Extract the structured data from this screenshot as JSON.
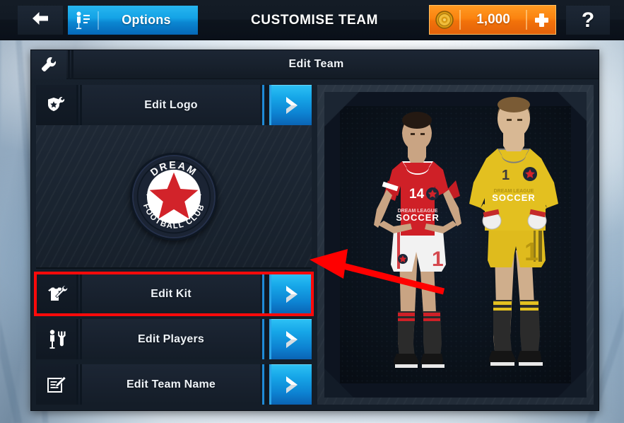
{
  "topbar": {
    "back_icon": "arrow-left-icon",
    "options_icon": "player-list-icon",
    "options_label": "Options",
    "screen_title": "CUSTOMISE TEAM",
    "coins_icon": "coin-icon",
    "coins_value": "1,000",
    "coins_add_icon": "plus-icon",
    "help_label": "?"
  },
  "panel": {
    "header_icon": "wrench-icon",
    "header_title": "Edit Team"
  },
  "menu": {
    "rows": [
      {
        "id": "edit-logo",
        "label": "Edit Logo",
        "icon": "shield-star-wrench-icon",
        "arrow_icon": "chevron-right-icon",
        "highlighted": false
      },
      {
        "id": "edit-kit",
        "label": "Edit Kit",
        "icon": "shirt-wrench-icon",
        "arrow_icon": "chevron-right-icon",
        "highlighted": true
      },
      {
        "id": "edit-players",
        "label": "Edit Players",
        "icon": "player-wrench-icon",
        "arrow_icon": "chevron-right-icon",
        "highlighted": false
      },
      {
        "id": "edit-team-name",
        "label": "Edit Team Name",
        "icon": "document-pencil-icon",
        "arrow_icon": "chevron-right-icon",
        "highlighted": false
      }
    ]
  },
  "logo": {
    "top_text": "DREAM",
    "bottom_text": "FOOTBALL CLUB",
    "shape": "star",
    "colors": {
      "ring": "#1b2434",
      "field": "#ffffff",
      "star": "#d2232a"
    }
  },
  "preview": {
    "outfield_player": {
      "number": "14",
      "kit_sponsor": "DREAM LEAGUE SOCCER",
      "shirt_color": "#cf2027",
      "shorts_color": "#f2f2f2",
      "socks_color": "#2a2a2a"
    },
    "goalkeeper": {
      "number": "1",
      "kit_sponsor": "DREAM LEAGUE SOCCER",
      "shirt_color": "#e3c020",
      "shorts_color": "#dfbb1d",
      "socks_color": "#2a2a2a"
    }
  },
  "annotation": {
    "type": "arrow",
    "color": "#ff0000",
    "points_to": "edit-kit",
    "highlight_color": "#ff0a0a"
  }
}
